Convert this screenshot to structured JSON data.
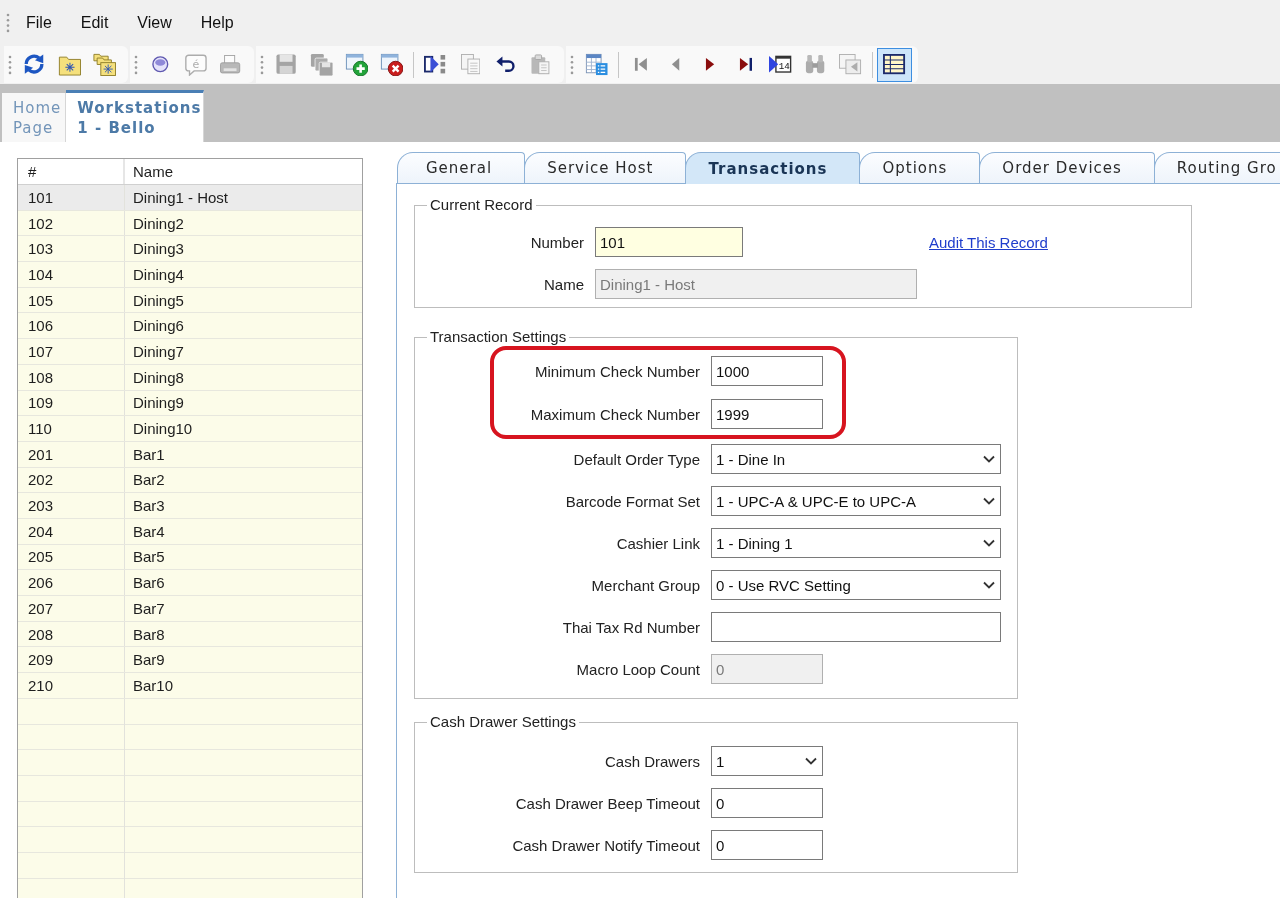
{
  "menu": [
    {
      "label": "File"
    },
    {
      "label": "Edit"
    },
    {
      "label": "View"
    },
    {
      "label": "Help"
    }
  ],
  "toolbar": {
    "strips": [
      {
        "groups": [
          {
            "buttons": [
              {
                "kind": "refresh",
                "disabled": false,
                "pressed": false
              },
              {
                "kind": "folder-star",
                "disabled": false,
                "pressed": false
              },
              {
                "kind": "folders-star",
                "disabled": false,
                "pressed": false
              }
            ]
          }
        ]
      },
      {
        "groups": [
          {
            "buttons": [
              {
                "kind": "disc",
                "disabled": false,
                "pressed": false
              },
              {
                "kind": "bubble",
                "text": "é",
                "disabled": true,
                "pressed": false
              },
              {
                "kind": "printer",
                "disabled": true,
                "pressed": false
              }
            ]
          }
        ]
      },
      {
        "groups": [
          {
            "buttons": [
              {
                "kind": "save",
                "disabled": true,
                "pressed": false
              },
              {
                "kind": "save-all",
                "disabled": true,
                "pressed": false
              },
              {
                "kind": "add",
                "disabled": false,
                "pressed": false
              },
              {
                "kind": "delete",
                "disabled": false,
                "pressed": false
              }
            ]
          },
          {
            "buttons": [
              {
                "kind": "insert",
                "disabled": false,
                "pressed": false
              },
              {
                "kind": "copy",
                "disabled": true,
                "pressed": false
              },
              {
                "kind": "undo",
                "disabled": false,
                "pressed": false
              },
              {
                "kind": "paste",
                "disabled": true,
                "pressed": false
              }
            ]
          }
        ]
      },
      {
        "groups": [
          {
            "buttons": [
              {
                "kind": "table-list",
                "disabled": false,
                "pressed": false
              }
            ]
          },
          {
            "buttons": [
              {
                "kind": "first",
                "disabled": true,
                "pressed": false
              },
              {
                "kind": "previous",
                "disabled": true,
                "pressed": false
              },
              {
                "kind": "next",
                "disabled": false,
                "pressed": false
              },
              {
                "kind": "last",
                "disabled": false,
                "pressed": false
              },
              {
                "kind": "goto",
                "text": "14",
                "disabled": false,
                "pressed": false
              },
              {
                "kind": "binoculars",
                "disabled": true,
                "pressed": false
              },
              {
                "kind": "window-arrow",
                "disabled": true,
                "pressed": false
              }
            ]
          },
          {
            "buttons": [
              {
                "kind": "grid",
                "disabled": false,
                "pressed": true
              }
            ]
          }
        ]
      }
    ]
  },
  "document_tabs": [
    {
      "label": "Home Page",
      "selected": false
    },
    {
      "label": "Workstations 1 - Bello",
      "selected": true
    }
  ],
  "record_list": {
    "columns": [
      "#",
      "Name"
    ],
    "rows": [
      {
        "number": "101",
        "name": "Dining1 - Host",
        "selected": true
      },
      {
        "number": "102",
        "name": "Dining2",
        "selected": false
      },
      {
        "number": "103",
        "name": "Dining3",
        "selected": false
      },
      {
        "number": "104",
        "name": "Dining4",
        "selected": false
      },
      {
        "number": "105",
        "name": "Dining5",
        "selected": false
      },
      {
        "number": "106",
        "name": "Dining6",
        "selected": false
      },
      {
        "number": "107",
        "name": "Dining7",
        "selected": false
      },
      {
        "number": "108",
        "name": "Dining8",
        "selected": false
      },
      {
        "number": "109",
        "name": "Dining9",
        "selected": false
      },
      {
        "number": "110",
        "name": "Dining10",
        "selected": false
      },
      {
        "number": "201",
        "name": "Bar1",
        "selected": false
      },
      {
        "number": "202",
        "name": "Bar2",
        "selected": false
      },
      {
        "number": "203",
        "name": "Bar3",
        "selected": false
      },
      {
        "number": "204",
        "name": "Bar4",
        "selected": false
      },
      {
        "number": "205",
        "name": "Bar5",
        "selected": false
      },
      {
        "number": "206",
        "name": "Bar6",
        "selected": false
      },
      {
        "number": "207",
        "name": "Bar7",
        "selected": false
      },
      {
        "number": "208",
        "name": "Bar8",
        "selected": false
      },
      {
        "number": "209",
        "name": "Bar9",
        "selected": false
      },
      {
        "number": "210",
        "name": "Bar10",
        "selected": false
      }
    ]
  },
  "tabs": [
    {
      "label": "General",
      "selected": false
    },
    {
      "label": "Service Host",
      "selected": false
    },
    {
      "label": "Transactions",
      "selected": true
    },
    {
      "label": "Options",
      "selected": false
    },
    {
      "label": "Order Devices",
      "selected": false
    },
    {
      "label": "Routing Gro",
      "selected": false
    }
  ],
  "current_record": {
    "legend": "Current Record",
    "fields": [
      {
        "label": "Number",
        "kind": "key",
        "value": "101",
        "disabled": false
      },
      {
        "label": "Name",
        "kind": "text",
        "value": "Dining1 - Host",
        "disabled": true
      }
    ],
    "link": "Audit This Record"
  },
  "transaction_settings": {
    "legend": "Transaction Settings",
    "groups": [
      {
        "highlighted": true,
        "fields": [
          {
            "label": "Minimum Check Number",
            "kind": "number",
            "value": "1000",
            "disabled": false
          },
          {
            "label": "Maximum Check Number",
            "kind": "number",
            "value": "1999",
            "disabled": false
          }
        ]
      },
      {
        "highlighted": false,
        "fields": [
          {
            "label": "Default Order Type",
            "kind": "select",
            "value": "1 - Dine In",
            "disabled": false
          },
          {
            "label": "Barcode Format Set",
            "kind": "select",
            "value": "1 - UPC-A & UPC-E to UPC-A",
            "disabled": false
          },
          {
            "label": "Cashier Link",
            "kind": "select",
            "value": "1 - Dining 1",
            "disabled": false
          },
          {
            "label": "Merchant Group",
            "kind": "select",
            "value": "0 - Use RVC Setting",
            "disabled": false
          },
          {
            "label": "Thai Tax Rd Number",
            "kind": "text",
            "disabled": false
          },
          {
            "label": "Macro Loop Count",
            "kind": "number",
            "value": "0",
            "disabled": true
          }
        ]
      }
    ]
  },
  "cash_drawer_settings": {
    "legend": "Cash Drawer Settings",
    "fields": [
      {
        "label": "Cash Drawers",
        "kind": "number-select",
        "value": "1",
        "disabled": false
      },
      {
        "label": "Cash Drawer Beep Timeout",
        "kind": "number",
        "value": "0",
        "disabled": false
      },
      {
        "label": "Cash Drawer Notify Timeout",
        "kind": "number",
        "value": "0",
        "disabled": false
      }
    ]
  }
}
